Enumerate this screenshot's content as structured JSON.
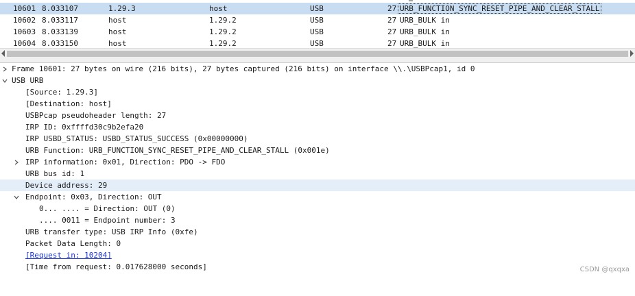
{
  "packet_list": {
    "rows": [
      {
        "no": "10601",
        "time": "8.033107",
        "source": "1.29.3",
        "destination": "host",
        "protocol": "USB",
        "length": "27",
        "info": "URB_FUNCTION_SYNC_RESET_PIPE_AND_CLEAR_STALL",
        "selected": true
      },
      {
        "no": "10602",
        "time": "8.033117",
        "source": "host",
        "destination": "1.29.2",
        "protocol": "USB",
        "length": "27",
        "info": "URB_BULK in",
        "selected": false
      },
      {
        "no": "10603",
        "time": "8.033139",
        "source": "host",
        "destination": "1.29.2",
        "protocol": "USB",
        "length": "27",
        "info": "URB_BULK in",
        "selected": false
      },
      {
        "no": "10604",
        "time": "8.033150",
        "source": "host",
        "destination": "1.29.2",
        "protocol": "USB",
        "length": "27",
        "info": "URB_BULK in",
        "selected": false
      }
    ]
  },
  "details": {
    "frame": "Frame 10601: 27 bytes on wire (216 bits), 27 bytes captured (216 bits) on interface \\\\.\\USBPcap1, id 0",
    "usb_urb": "USB URB",
    "source": "[Source: 1.29.3]",
    "destination": "[Destination: host]",
    "pseudoheader": "USBPcap pseudoheader length: 27",
    "irp_id": "IRP ID: 0xffffd30c9b2efa20",
    "usbd_status": "IRP USBD_STATUS: USBD_STATUS_SUCCESS (0x00000000)",
    "urb_function": "URB Function: URB_FUNCTION_SYNC_RESET_PIPE_AND_CLEAR_STALL (0x001e)",
    "irp_info": "IRP information: 0x01, Direction: PDO -> FDO",
    "bus_id": "URB bus id: 1",
    "device_address": "Device address: 29",
    "endpoint": "Endpoint: 0x03, Direction: OUT",
    "ep_direction": "0... .... = Direction: OUT (0)",
    "ep_number": ".... 0011 = Endpoint number: 3",
    "transfer_type": "URB transfer type: USB IRP Info (0xfe)",
    "packet_data_length": "Packet Data Length: 0",
    "request_in": "[Request in: 10204]",
    "time_from_request": "[Time from request: 0.017628000 seconds]"
  },
  "watermark": "CSDN @qxqxa"
}
